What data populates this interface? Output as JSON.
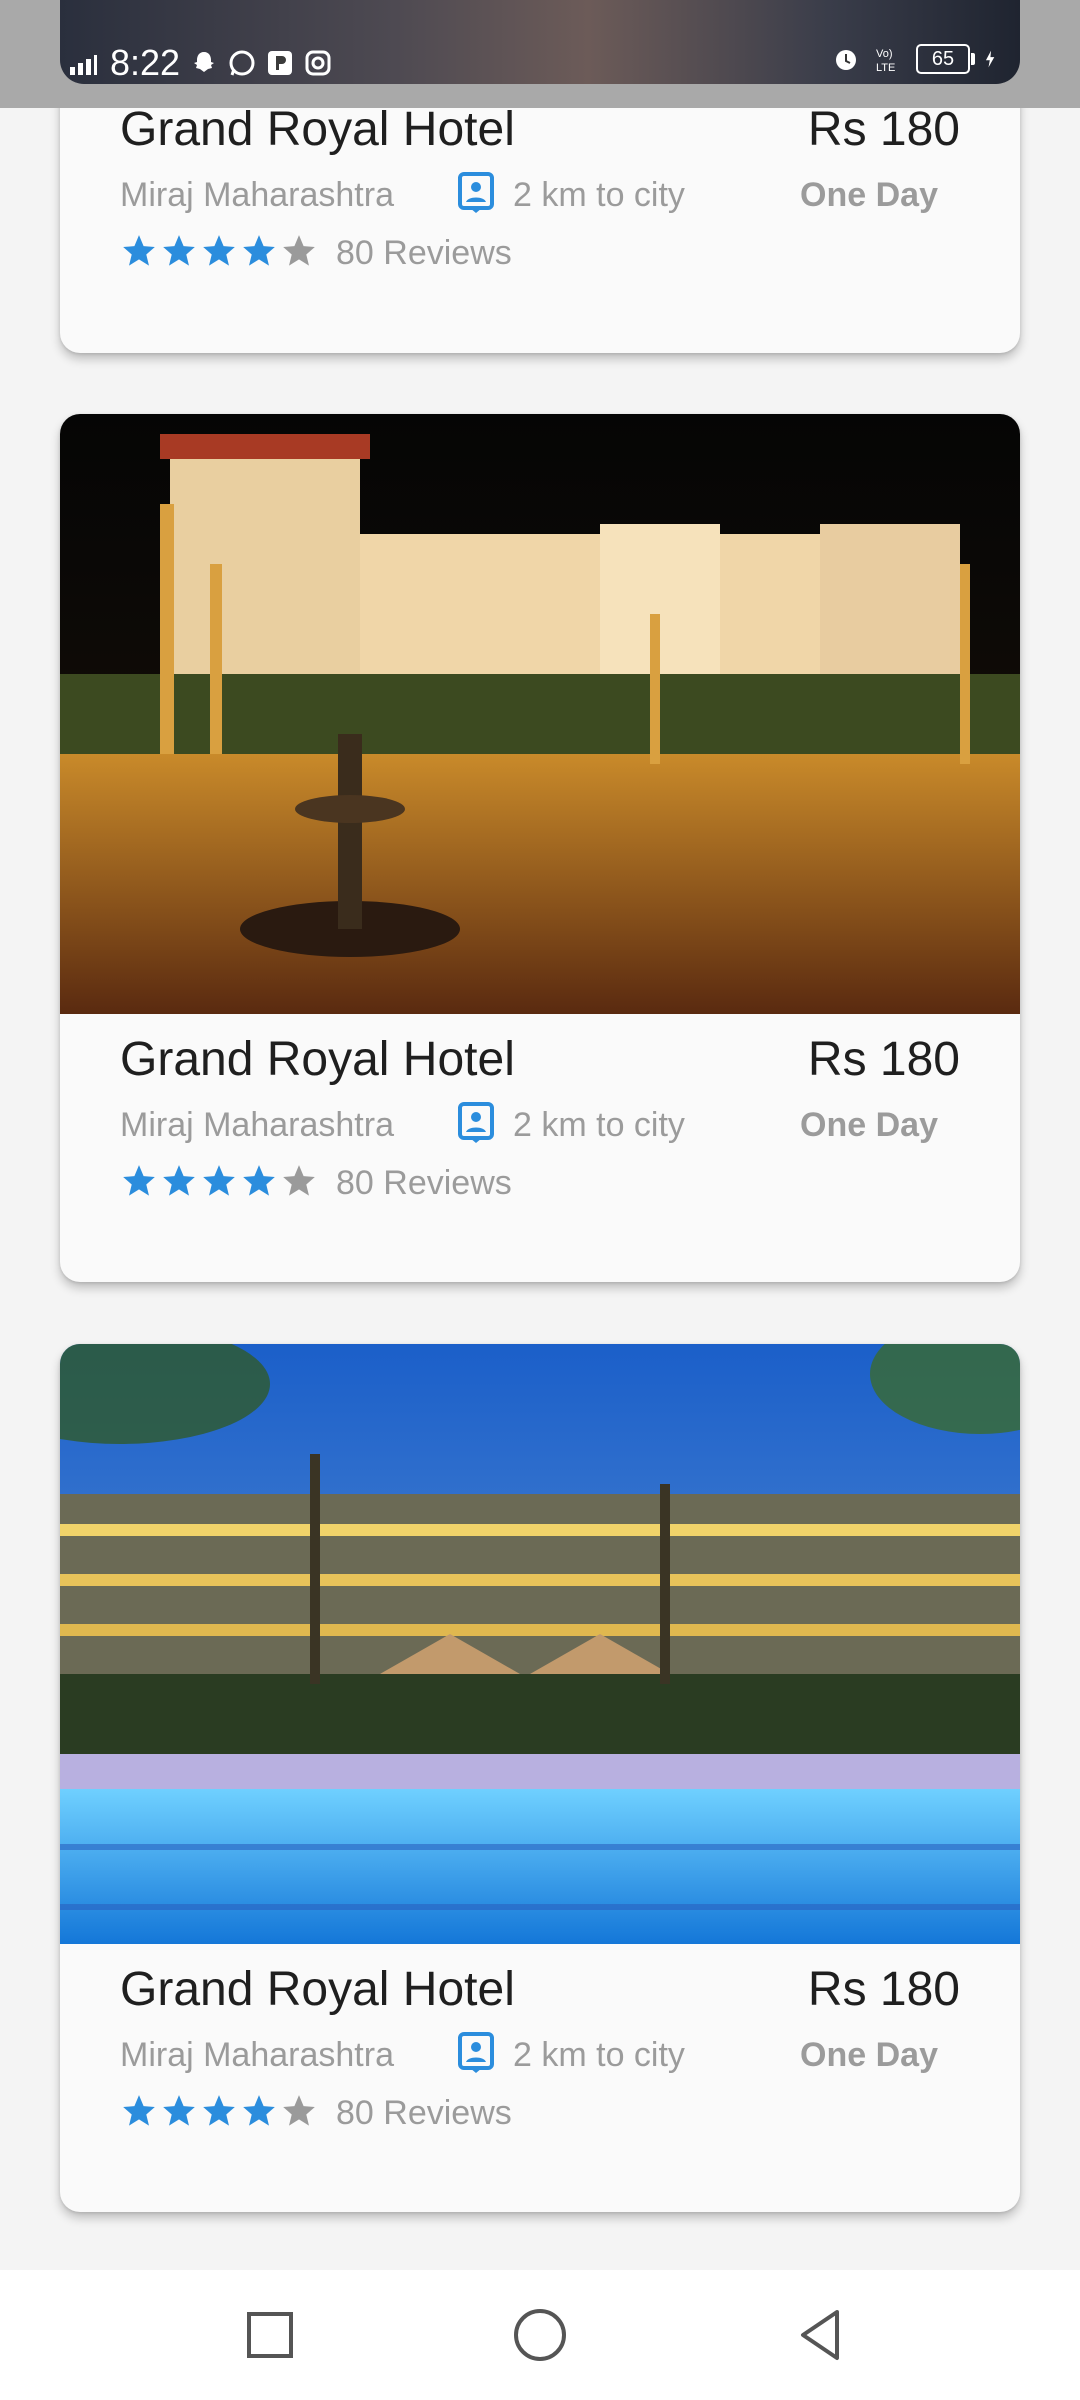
{
  "status_bar": {
    "time": "8:22",
    "battery": "65",
    "network_label": "Vo LTE"
  },
  "hotels": [
    {
      "name": "Grand Royal Hotel",
      "price": "Rs 180",
      "location": "Miraj Maharashtra",
      "distance": "2 km to city",
      "duration": "One Day",
      "rating": 4,
      "rating_max": 5,
      "reviews": "80 Reviews"
    },
    {
      "name": "Grand Royal Hotel",
      "price": "Rs 180",
      "location": "Miraj Maharashtra",
      "distance": "2 km to city",
      "duration": "One Day",
      "rating": 4,
      "rating_max": 5,
      "reviews": "80 Reviews"
    },
    {
      "name": "Grand Royal Hotel",
      "price": "Rs 180",
      "location": "Miraj Maharashtra",
      "distance": "2 km to city",
      "duration": "One Day",
      "rating": 4,
      "rating_max": 5,
      "reviews": "80 Reviews"
    }
  ],
  "colors": {
    "star_active": "#2b8ddd",
    "star_inactive": "#9a9a9a",
    "accent": "#2b8ddd"
  },
  "icons": {
    "distance": "location-pin-icon",
    "nav_recent": "square-icon",
    "nav_home": "circle-icon",
    "nav_back": "triangle-back-icon"
  }
}
